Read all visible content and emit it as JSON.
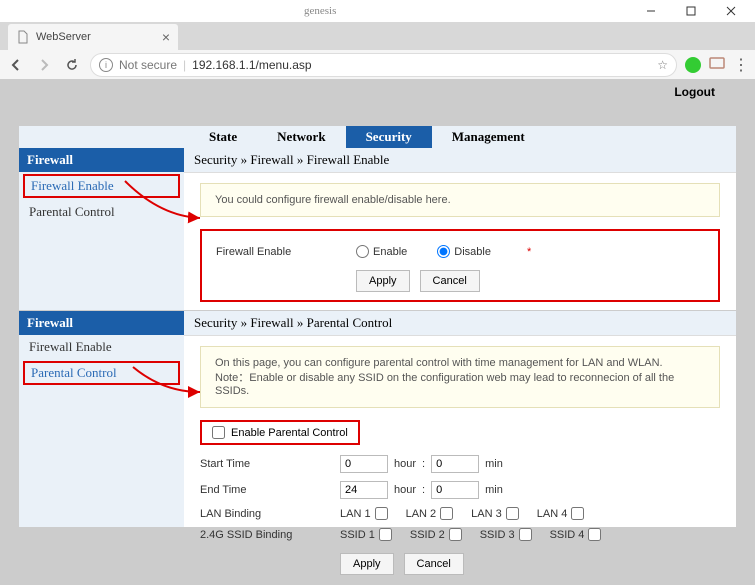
{
  "browser": {
    "app_name": "genesis",
    "tab_title": "WebServer",
    "not_secure": "Not secure",
    "url": "192.168.1.1/menu.asp"
  },
  "logout": "Logout",
  "topnav": {
    "items": [
      "State",
      "Network",
      "Security",
      "Management"
    ],
    "active": 2
  },
  "sidebar": {
    "header": "Firewall",
    "items": [
      "Firewall Enable",
      "Parental Control"
    ]
  },
  "panel1": {
    "breadcrumb": "Security » Firewall » Firewall Enable",
    "info": "You could configure firewall enable/disable here.",
    "label": "Firewall Enable",
    "opt_enable": "Enable",
    "opt_disable": "Disable",
    "apply": "Apply",
    "cancel": "Cancel"
  },
  "panel2": {
    "breadcrumb": "Security » Firewall » Parental Control",
    "info": "On this page, you can configure parental control with time management for LAN and WLAN.\nNote：Enable or disable any SSID on the configuration web may lead to reconnecion of all the SSIDs.",
    "enable_pc": "Enable Parental Control",
    "start_time": "Start Time",
    "end_time": "End Time",
    "hour": "hour",
    "min": "min",
    "sep": ":",
    "start_h": "0",
    "start_m": "0",
    "end_h": "24",
    "end_m": "0",
    "lan_binding": "LAN Binding",
    "lan": [
      "LAN 1",
      "LAN 2",
      "LAN 3",
      "LAN 4"
    ],
    "ssid_binding": "2.4G SSID Binding",
    "ssid": [
      "SSID 1",
      "SSID 2",
      "SSID 3",
      "SSID 4"
    ],
    "apply": "Apply",
    "cancel": "Cancel"
  }
}
